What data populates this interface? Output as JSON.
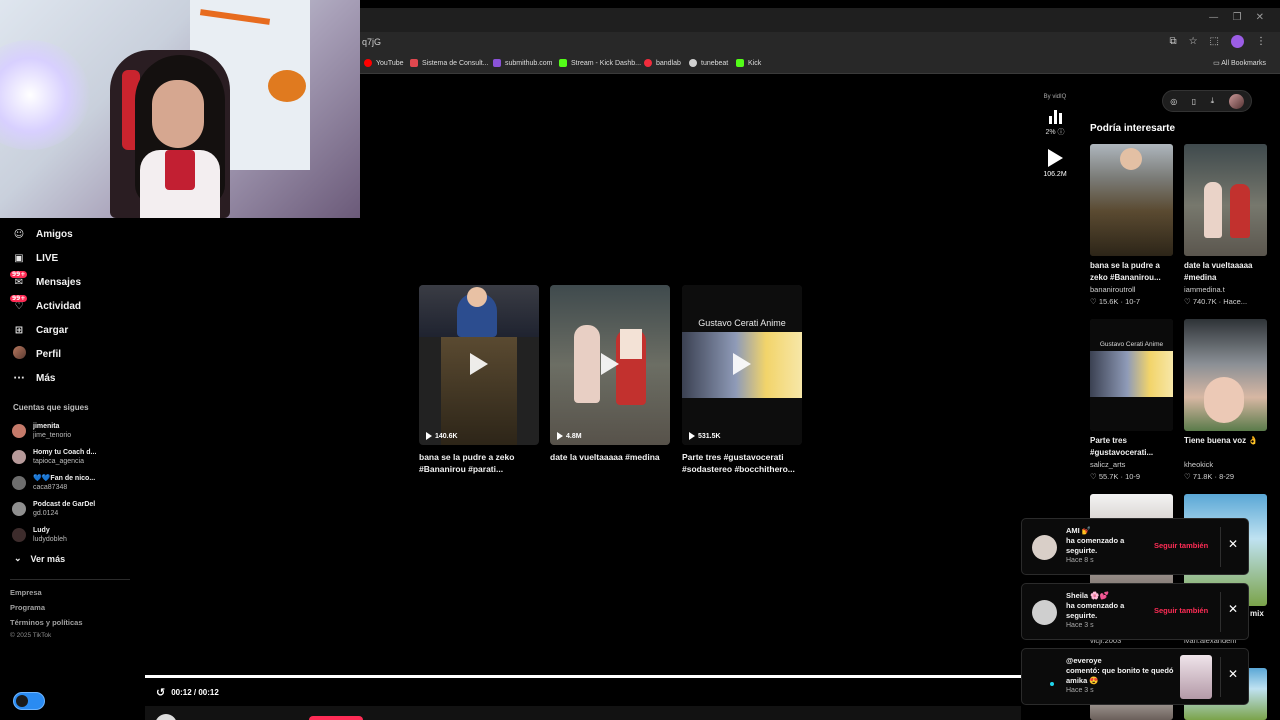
{
  "browser": {
    "url_fragment": "q7jG",
    "bookmarks": [
      {
        "label": "YouTube",
        "color": "#ff0000"
      },
      {
        "label": "Sistema de Consult...",
        "color": "#e0484f"
      },
      {
        "label": "submithub.com",
        "color": "#8a52d8"
      },
      {
        "label": "Stream - Kick Dashb...",
        "color": "#53fc18"
      },
      {
        "label": "bandlab",
        "color": "#f12c3c"
      },
      {
        "label": "tunebeat",
        "color": "#d0d0d0"
      },
      {
        "label": "Kick",
        "color": "#53fc18"
      }
    ],
    "all_bookmarks": "All Bookmarks"
  },
  "sidebar": {
    "nav": [
      {
        "label": "Amigos",
        "icon": "friends-icon"
      },
      {
        "label": "LIVE",
        "icon": "live-icon"
      },
      {
        "label": "Mensajes",
        "icon": "messages-icon",
        "badge": "99+"
      },
      {
        "label": "Actividad",
        "icon": "activity-icon",
        "badge": "99+"
      },
      {
        "label": "Cargar",
        "icon": "upload-icon"
      },
      {
        "label": "Perfil",
        "icon": "profile-avatar"
      },
      {
        "label": "Más",
        "icon": "more-icon"
      }
    ],
    "following_title": "Cuentas que sigues",
    "following": [
      {
        "name": "jimenita",
        "user": "jime_tenorio",
        "color": "#c57a6a"
      },
      {
        "name": "Homy tu Coach d...",
        "user": "tapioca_agencia",
        "color": "#b79a9a"
      },
      {
        "name": "💙💙Fan de nico...",
        "user": "caca87348",
        "color": "#6d6d6d"
      },
      {
        "name": "Podcast de GarDel",
        "user": "gd.0124",
        "color": "#8f8f8f"
      },
      {
        "name": "Ludy",
        "user": "ludydobleh",
        "color": "#3d2c2c"
      }
    ],
    "see_more": "Ver más",
    "footer_links": [
      "Empresa",
      "Programa",
      "Términos y políticas"
    ],
    "copyright": "© 2025 TikTok"
  },
  "videos": [
    {
      "views": "140.6K",
      "caption": "bana se la pudre a zeko #Bananirou #parati..."
    },
    {
      "views": "4.8M",
      "caption": "date la vueltaaaaa #medina"
    },
    {
      "views": "531.5K",
      "caption": "Parte tres #gustavocerati #sodastereo #bocchithero...",
      "thumb_title": "Gustavo Cerati Anime"
    }
  ],
  "video_stats": {
    "by_label": "By vidIQ",
    "percent": "2%",
    "plays": "106.2M"
  },
  "recommendations": {
    "title": "Podría interesarte",
    "items": [
      {
        "caption": "bana se la pudre a zeko #Bananirou...",
        "user": "bananiroutroll",
        "likes": "15.6K",
        "date": "10-7"
      },
      {
        "caption": "date la vueltaaaaa #medina",
        "user": "iammedina.t",
        "likes": "740.7K",
        "date": "Hace..."
      },
      {
        "caption": "Parte tres #gustavocerati...",
        "user": "salicz_arts",
        "likes": "55.7K",
        "date": "10-9",
        "thumb_title": "Gustavo Cerati Anime"
      },
      {
        "caption": "Tiene buena voz 👌",
        "user": "kheokick",
        "likes": "71.8K",
        "date": "8-29"
      }
    ],
    "partial_caption": "mix",
    "partial_user_left": "vicji.2003",
    "partial_user_right": "ivan.alexandem"
  },
  "notifications": [
    {
      "name": "AMI 💅",
      "message": "ha comenzado a seguirte.",
      "time": "Hace 8 s",
      "action": "Seguir también",
      "avatar_color": "#d9cfc8"
    },
    {
      "name": "Sheila 🌸💕",
      "message": "ha comenzado a seguirte.",
      "time": "Hace 3 s",
      "action": "Seguir también",
      "avatar_color": "#cfcfcf"
    },
    {
      "name": "@everoye",
      "message": "comentó: que bonito te quedó amika 😍",
      "time": "Hace 3 s"
    }
  ],
  "player": {
    "time": "00:12 / 00:12",
    "progress": 1.0
  }
}
